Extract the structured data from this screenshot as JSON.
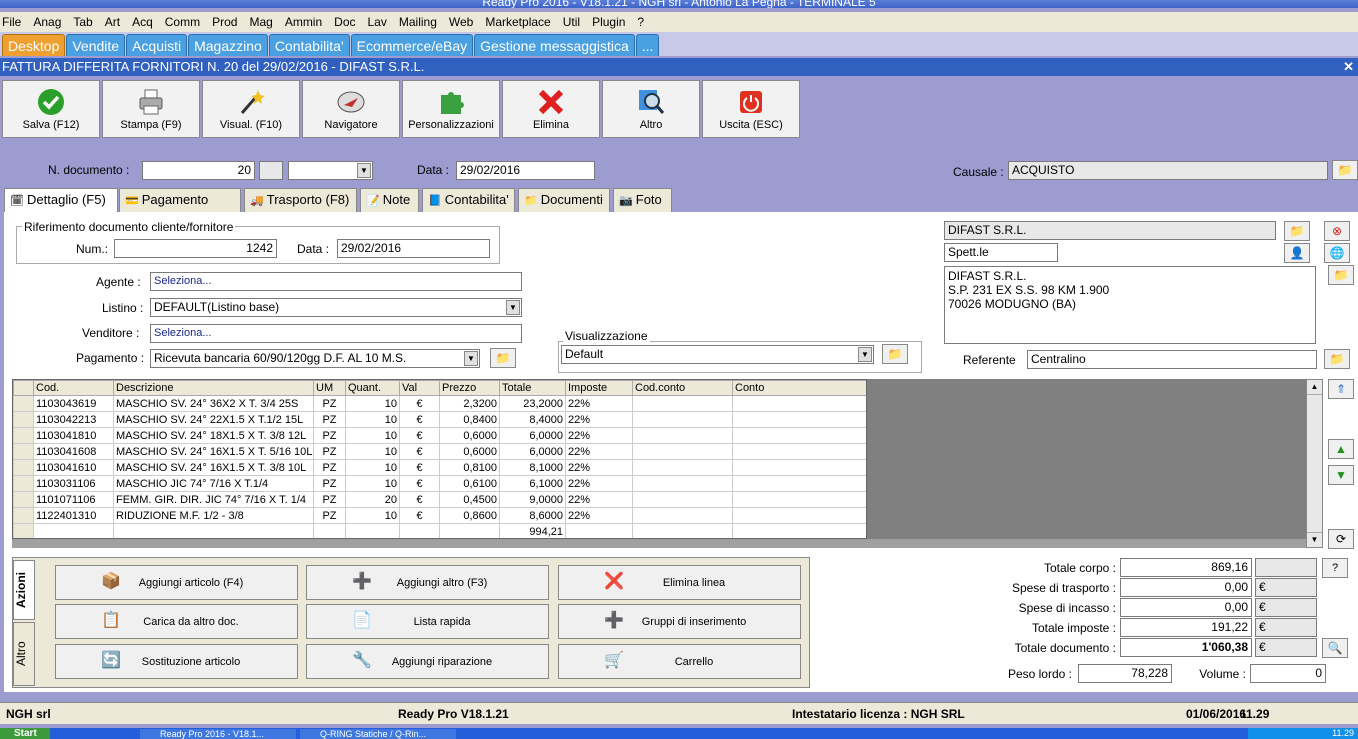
{
  "window": {
    "title": "Ready Pro 2016 - V18.1.21 - NGH srl - Antonio La Pegna - TERMINALE 5"
  },
  "menu": [
    "File",
    "Anag",
    "Tab",
    "Art",
    "Acq",
    "Comm",
    "Prod",
    "Mag",
    "Ammin",
    "Doc",
    "Lav",
    "Mailing",
    "Web",
    "Marketplace",
    "Util",
    "Plugin",
    "?"
  ],
  "top_tabs": [
    "Desktop",
    "Vendite",
    "Acquisti",
    "Magazzino",
    "Contabilita'",
    "Ecommerce/eBay",
    "Gestione messaggistica",
    "..."
  ],
  "document_title": "FATTURA DIFFERITA FORNITORI N. 20 del 29/02/2016 - DIFAST S.R.L.",
  "toolbar": {
    "save": "Salva (F12)",
    "print": "Stampa (F9)",
    "view": "Visual. (F10)",
    "navigator": "Navigatore",
    "custom": "Personalizzazioni",
    "delete": "Elimina",
    "other": "Altro",
    "exit": "Uscita (ESC)"
  },
  "header": {
    "ndoc_label": "N. documento :",
    "ndoc_value": "20",
    "data_label": "Data :",
    "data_value": "29/02/2016",
    "causale_label": "Causale :",
    "causale_value": "ACQUISTO"
  },
  "sub_tabs": [
    "Dettaglio (F5)",
    "Pagamento (F6)",
    "Trasporto (F8)",
    "Note",
    "Contabilita'",
    "Documenti",
    "Foto"
  ],
  "ref": {
    "group_label": "Riferimento documento cliente/fornitore",
    "num_label": "Num.:",
    "num_value": "1242",
    "data_label": "Data :",
    "data_value": "29/02/2016"
  },
  "fields": {
    "agente_label": "Agente :",
    "agente_value": "Seleziona...",
    "listino_label": "Listino :",
    "listino_value": "DEFAULT(Listino base)",
    "venditore_label": "Venditore :",
    "venditore_value": "Seleziona...",
    "pagamento_label": "Pagamento :",
    "pagamento_value": "Ricevuta bancaria 60/90/120gg D.F. AL 10 M.S.",
    "visual_label": "Visualizzazione",
    "visual_value": "Default"
  },
  "supplier": {
    "name": "DIFAST S.R.L.",
    "salutation": "Spett.le",
    "address_lines": [
      "DIFAST S.R.L.",
      "S.P. 231 EX S.S. 98 KM 1.900",
      "70026 MODUGNO (BA)"
    ],
    "referente_label": "Referente",
    "referente_value": "Centralino"
  },
  "grid": {
    "columns": [
      "",
      "Cod.",
      "Descrizione",
      "UM",
      "Quant.",
      "Val",
      "Prezzo",
      "Totale",
      "Imposte",
      "Cod.conto",
      "Conto"
    ],
    "rows": [
      [
        "",
        "1103043619",
        "MASCHIO SV. 24° 36X2 X T. 3/4 25S",
        "PZ",
        "10",
        "€",
        "2,3200",
        "23,2000",
        "22%",
        "",
        ""
      ],
      [
        "",
        "1103042213",
        "MASCHIO SV. 24° 22X1.5 X T.1/2 15L",
        "PZ",
        "10",
        "€",
        "0,8400",
        "8,4000",
        "22%",
        "",
        ""
      ],
      [
        "",
        "1103041810",
        "MASCHIO SV. 24° 18X1.5 X T. 3/8 12L",
        "PZ",
        "10",
        "€",
        "0,6000",
        "6,0000",
        "22%",
        "",
        ""
      ],
      [
        "",
        "1103041608",
        "MASCHIO SV. 24° 16X1.5 X T. 5/16 10L",
        "PZ",
        "10",
        "€",
        "0,6000",
        "6,0000",
        "22%",
        "",
        ""
      ],
      [
        "",
        "1103041610",
        "MASCHIO SV. 24° 16X1.5 X T. 3/8 10L",
        "PZ",
        "10",
        "€",
        "0,8100",
        "8,1000",
        "22%",
        "",
        ""
      ],
      [
        "",
        "1103031106",
        "MASCHIO JIC 74° 7/16 X T.1/4",
        "PZ",
        "10",
        "€",
        "0,6100",
        "6,1000",
        "22%",
        "",
        ""
      ],
      [
        "",
        "1101071106",
        "FEMM. GIR. DIR. JIC 74° 7/16 X T. 1/4",
        "PZ",
        "20",
        "€",
        "0,4500",
        "9,0000",
        "22%",
        "",
        ""
      ],
      [
        "",
        "1122401310",
        "RIDUZIONE M.F. 1/2 - 3/8",
        "PZ",
        "10",
        "€",
        "0,8600",
        "8,6000",
        "22%",
        "",
        ""
      ],
      [
        "",
        "",
        "",
        "",
        "",
        "",
        "",
        "994,21",
        "",
        "",
        ""
      ]
    ]
  },
  "actions": {
    "tab_azioni": "Azioni",
    "tab_altro": "Altro",
    "buttons": [
      "Aggiungi articolo (F4)",
      "Aggiungi altro (F3)",
      "Elimina linea",
      "Carica da altro doc.",
      "Lista rapida",
      "Gruppi di inserimento",
      "Sostituzione articolo",
      "Aggiungi riparazione",
      "Carrello"
    ]
  },
  "totals": {
    "corpo_label": "Totale corpo :",
    "corpo_value": "869,16",
    "trasporto_label": "Spese di trasporto :",
    "trasporto_value": "0,00",
    "incasso_label": "Spese di incasso :",
    "incasso_value": "0,00",
    "imposte_label": "Totale imposte :",
    "imposte_value": "191,22",
    "documento_label": "Totale documento :",
    "documento_value": "1'060,38",
    "currency": "€",
    "help": "?",
    "peso_label": "Peso lordo :",
    "peso_value": "78,228",
    "volume_label": "Volume :",
    "volume_value": "0"
  },
  "status": {
    "company": "NGH srl",
    "version": "Ready Pro V18.1.21",
    "license": "Intestatario licenza : NGH SRL",
    "date": "01/06/2016",
    "time": "11.29"
  },
  "taskbar": {
    "start": "Start",
    "items": [
      "Ready Pro 2016 - V18.1...",
      "Q-RING Statiche / Q-Rin..."
    ],
    "clock": "11.29"
  },
  "colors": {
    "accent": "#3060c0",
    "desktop_tab": "#f0a030",
    "background": "#9c9cd0"
  }
}
